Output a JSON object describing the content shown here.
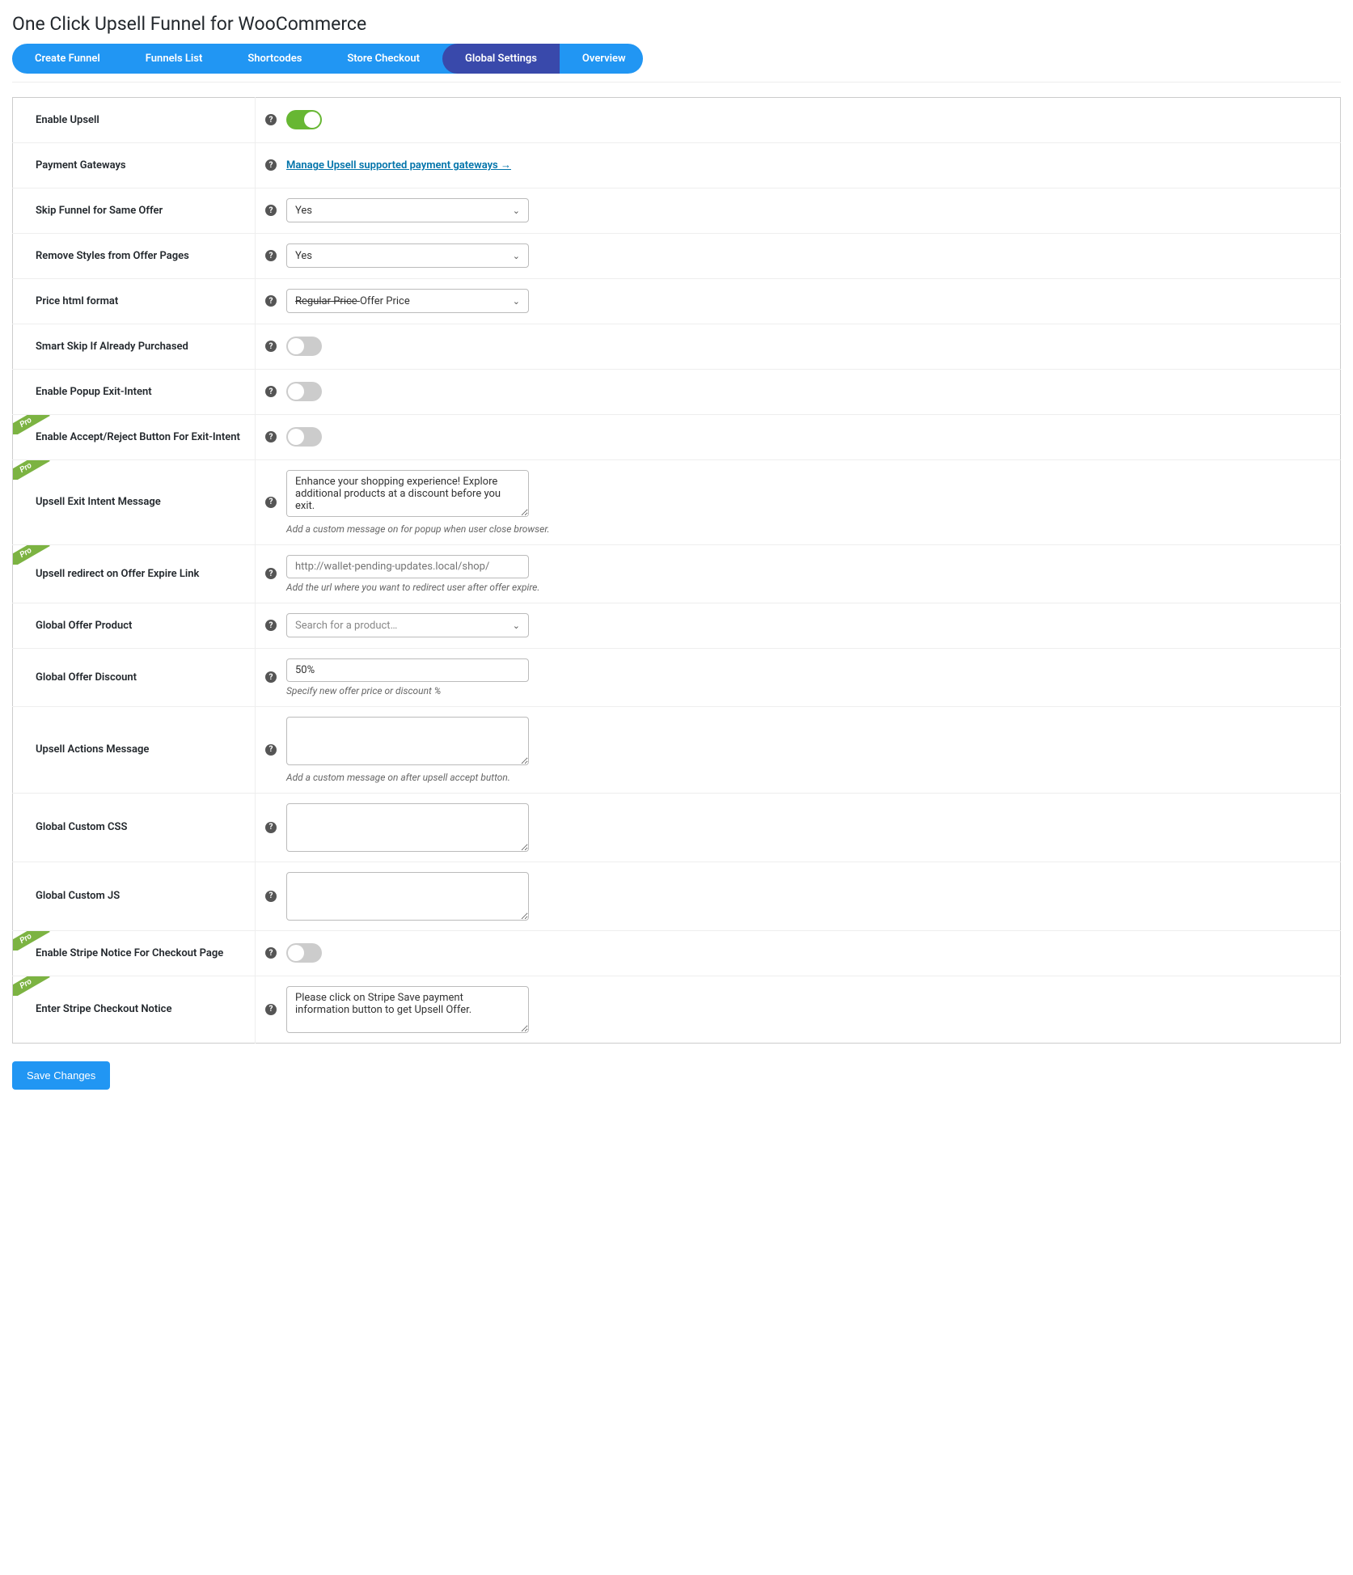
{
  "page": {
    "title": "One Click Upsell Funnel for WooCommerce"
  },
  "tabs": [
    {
      "label": "Create Funnel"
    },
    {
      "label": "Funnels List"
    },
    {
      "label": "Shortcodes"
    },
    {
      "label": "Store Checkout"
    },
    {
      "label": "Global Settings",
      "active": true
    },
    {
      "label": "Overview"
    }
  ],
  "rows": {
    "enable_upsell": {
      "label": "Enable Upsell"
    },
    "payment_gateways": {
      "label": "Payment Gateways",
      "link_text": "Manage Upsell supported payment gateways →"
    },
    "skip_funnel": {
      "label": "Skip Funnel for Same Offer",
      "value": "Yes"
    },
    "remove_styles": {
      "label": "Remove Styles from Offer Pages",
      "value": "Yes"
    },
    "price_format": {
      "label": "Price html format",
      "strike": "Regular Price ",
      "rest": "Offer Price"
    },
    "smart_skip": {
      "label": "Smart Skip If Already Purchased"
    },
    "enable_popup": {
      "label": "Enable Popup Exit-Intent"
    },
    "enable_accept_reject": {
      "label": "Enable Accept/Reject Button For Exit-Intent"
    },
    "exit_intent_message": {
      "label": "Upsell Exit Intent Message",
      "value": "Enhance your shopping experience! Explore additional products at a discount before you exit.",
      "helper": "Add a custom message on for popup when user close browser."
    },
    "redirect_on_expire": {
      "label": "Upsell redirect on Offer Expire Link",
      "placeholder": "http://wallet-pending-updates.local/shop/",
      "helper": "Add the url where you want to redirect user after offer expire."
    },
    "global_offer_product": {
      "label": "Global Offer Product",
      "placeholder": "Search for a product…"
    },
    "global_offer_discount": {
      "label": "Global Offer Discount",
      "value": "50%",
      "helper": "Specify new offer price or discount %"
    },
    "upsell_actions_message": {
      "label": "Upsell Actions Message",
      "helper": "Add a custom message on after upsell accept button."
    },
    "global_css": {
      "label": "Global Custom CSS"
    },
    "global_js": {
      "label": "Global Custom JS"
    },
    "enable_stripe_notice": {
      "label": "Enable Stripe Notice For Checkout Page"
    },
    "stripe_checkout_notice": {
      "label": "Enter Stripe Checkout Notice",
      "value": "Please click on Stripe Save payment information button to get Upsell Offer."
    }
  },
  "pro_label": "Pro",
  "save_label": "Save Changes"
}
